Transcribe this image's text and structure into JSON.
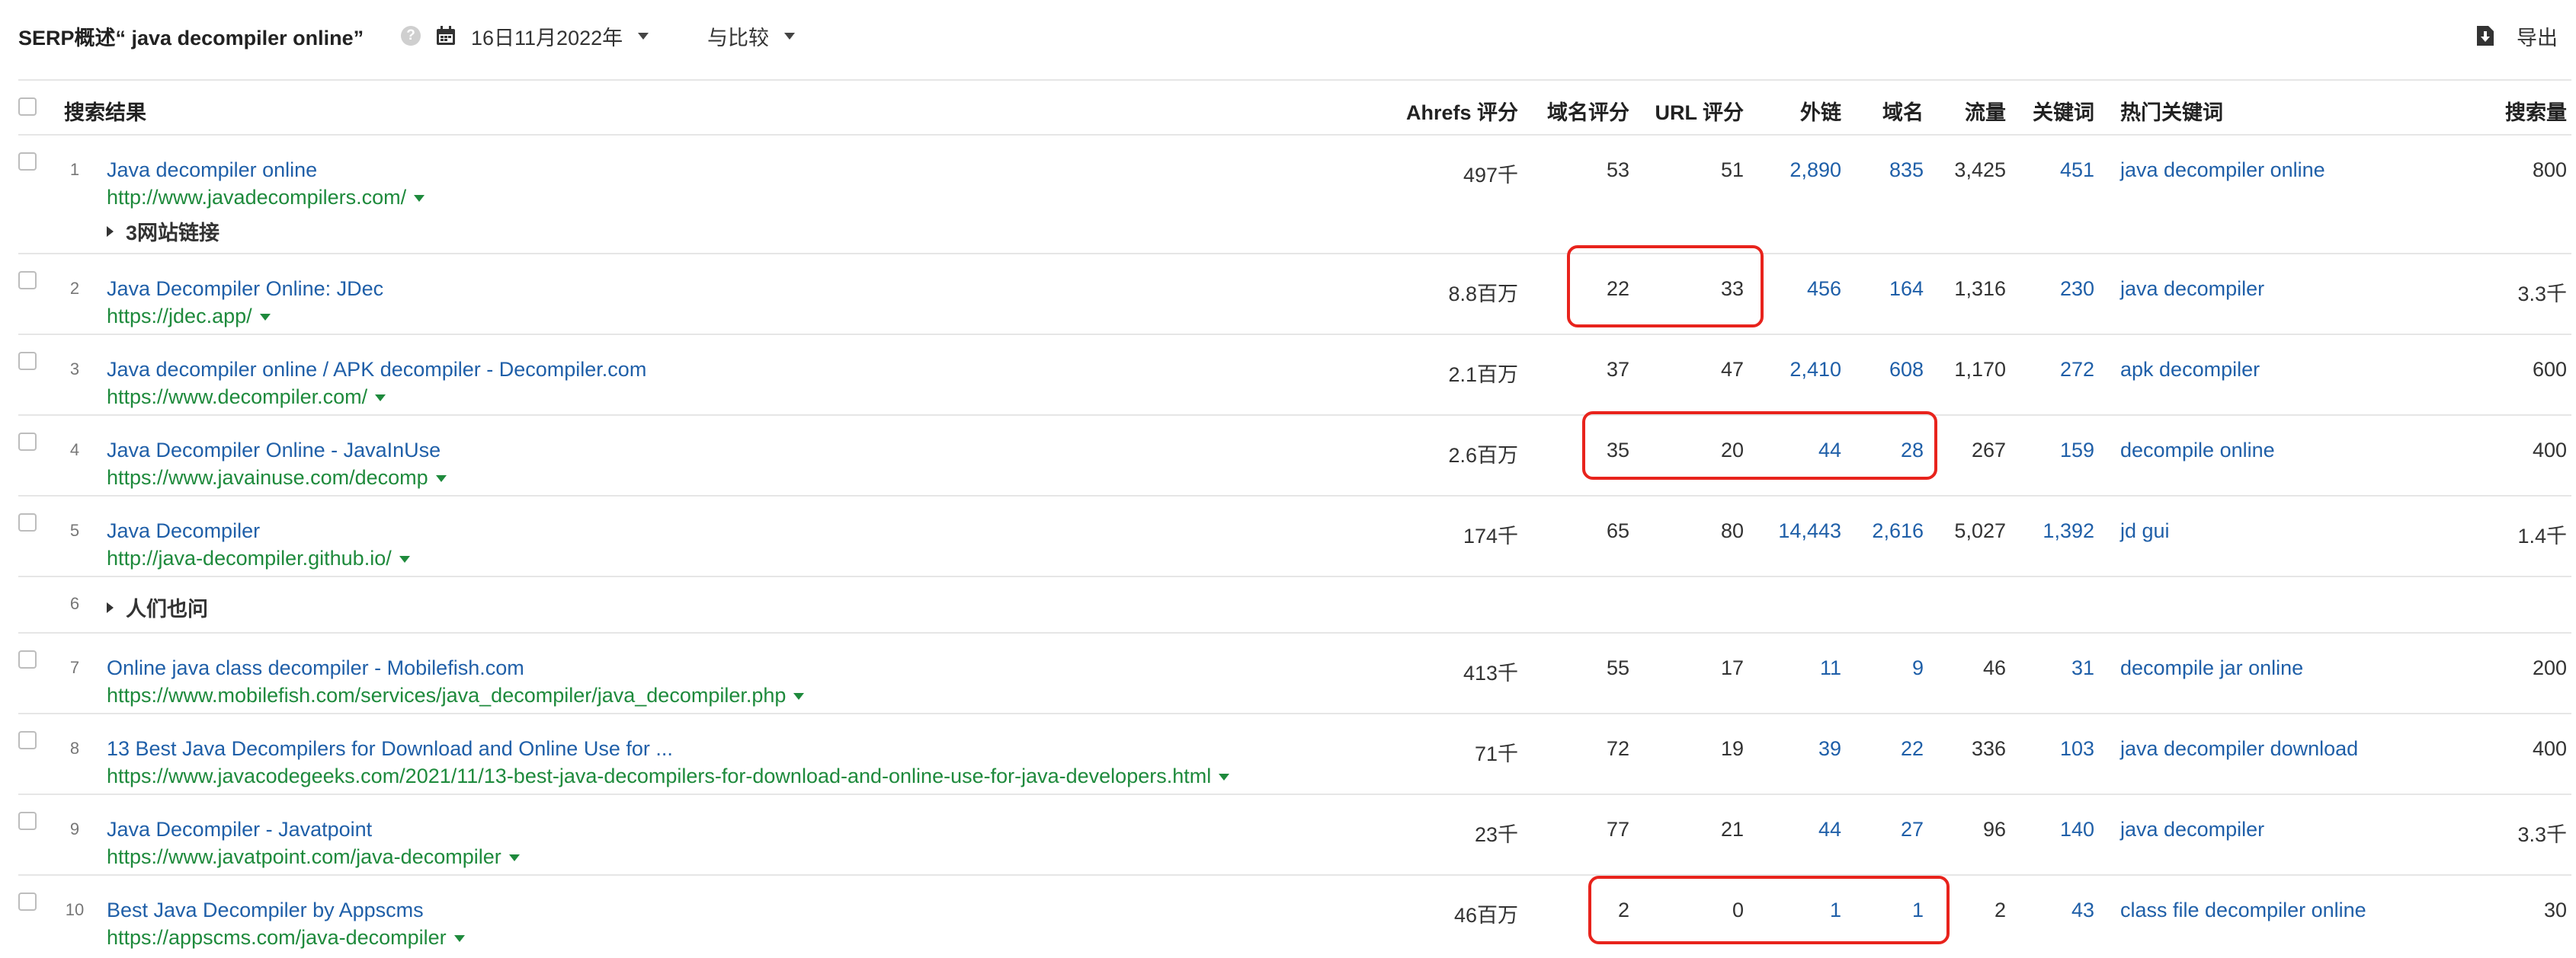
{
  "toolbar": {
    "title": "SERP概述“ java decompiler online”",
    "help_icon": "question-circle-icon",
    "date_label": "16日11月2022年",
    "compare_label": "与比较",
    "export_label": "导出"
  },
  "columns": {
    "result": "搜索结果",
    "ahrefs_rank": "Ahrefs 评分",
    "dr": "域名评分",
    "ur": "URL 评分",
    "backlinks": "外链",
    "ref_domains": "域名",
    "traffic": "流量",
    "keywords": "关键词",
    "top_keyword": "热门关键词",
    "volume": "搜索量"
  },
  "rows": [
    {
      "pos": "1",
      "title": "Java decompiler online",
      "url": "http://www.javadecompilers.com/",
      "ahrefs": "497千",
      "dr": "53",
      "ur": "51",
      "backlinks": "2,890",
      "domains": "835",
      "traffic": "3,425",
      "keywords": "451",
      "top_keyword": "java decompiler online",
      "volume": "800",
      "sub": "3网站链接"
    },
    {
      "pos": "2",
      "title": "Java Decompiler Online: JDec",
      "url": "https://jdec.app/",
      "ahrefs": "8.8百万",
      "dr": "22",
      "ur": "33",
      "backlinks": "456",
      "domains": "164",
      "traffic": "1,316",
      "keywords": "230",
      "top_keyword": "java decompiler",
      "volume": "3.3千"
    },
    {
      "pos": "3",
      "title": "Java decompiler online / APK decompiler - Decompiler.com",
      "url": "https://www.decompiler.com/",
      "ahrefs": "2.1百万",
      "dr": "37",
      "ur": "47",
      "backlinks": "2,410",
      "domains": "608",
      "traffic": "1,170",
      "keywords": "272",
      "top_keyword": "apk decompiler",
      "volume": "600"
    },
    {
      "pos": "4",
      "title": "Java Decompiler Online - JavaInUse",
      "url": "https://www.javainuse.com/decomp",
      "ahrefs": "2.6百万",
      "dr": "35",
      "ur": "20",
      "backlinks": "44",
      "domains": "28",
      "traffic": "267",
      "keywords": "159",
      "top_keyword": "decompile online",
      "volume": "400"
    },
    {
      "pos": "5",
      "title": "Java Decompiler",
      "url": "http://java-decompiler.github.io/",
      "ahrefs": "174千",
      "dr": "65",
      "ur": "80",
      "backlinks": "14,443",
      "domains": "2,616",
      "traffic": "5,027",
      "keywords": "1,392",
      "top_keyword": "jd gui",
      "volume": "1.4千"
    },
    {
      "pos": "7",
      "title": "Online java class decompiler - Mobilefish.com",
      "url": "https://www.mobilefish.com/services/java_decompiler/java_decompiler.php",
      "ahrefs": "413千",
      "dr": "55",
      "ur": "17",
      "backlinks": "11",
      "domains": "9",
      "traffic": "46",
      "keywords": "31",
      "top_keyword": "decompile jar online",
      "volume": "200"
    },
    {
      "pos": "8",
      "title": "13 Best Java Decompilers for Download and Online Use for ...",
      "url": "https://www.javacodegeeks.com/2021/11/13-best-java-decompilers-for-download-and-online-use-for-java-developers.html",
      "ahrefs": "71千",
      "dr": "72",
      "ur": "19",
      "backlinks": "39",
      "domains": "22",
      "traffic": "336",
      "keywords": "103",
      "top_keyword": "java decompiler download",
      "volume": "400"
    },
    {
      "pos": "9",
      "title": "Java Decompiler - Javatpoint",
      "url": "https://www.javatpoint.com/java-decompiler",
      "ahrefs": "23千",
      "dr": "77",
      "ur": "21",
      "backlinks": "44",
      "domains": "27",
      "traffic": "96",
      "keywords": "140",
      "top_keyword": "java decompiler",
      "volume": "3.3千"
    },
    {
      "pos": "10",
      "title": "Best Java Decompiler by Appscms",
      "url": "https://appscms.com/java-decompiler",
      "ahrefs": "46百万",
      "dr": "2",
      "ur": "0",
      "backlinks": "1",
      "domains": "1",
      "traffic": "2",
      "keywords": "43",
      "top_keyword": "class file decompiler online",
      "volume": "30"
    }
  ],
  "paa_row": {
    "pos": "6",
    "label": "人们也问"
  },
  "colors": {
    "link": "#1f5fa8",
    "url": "#1e8a3c",
    "highlight": "#e8231c"
  }
}
